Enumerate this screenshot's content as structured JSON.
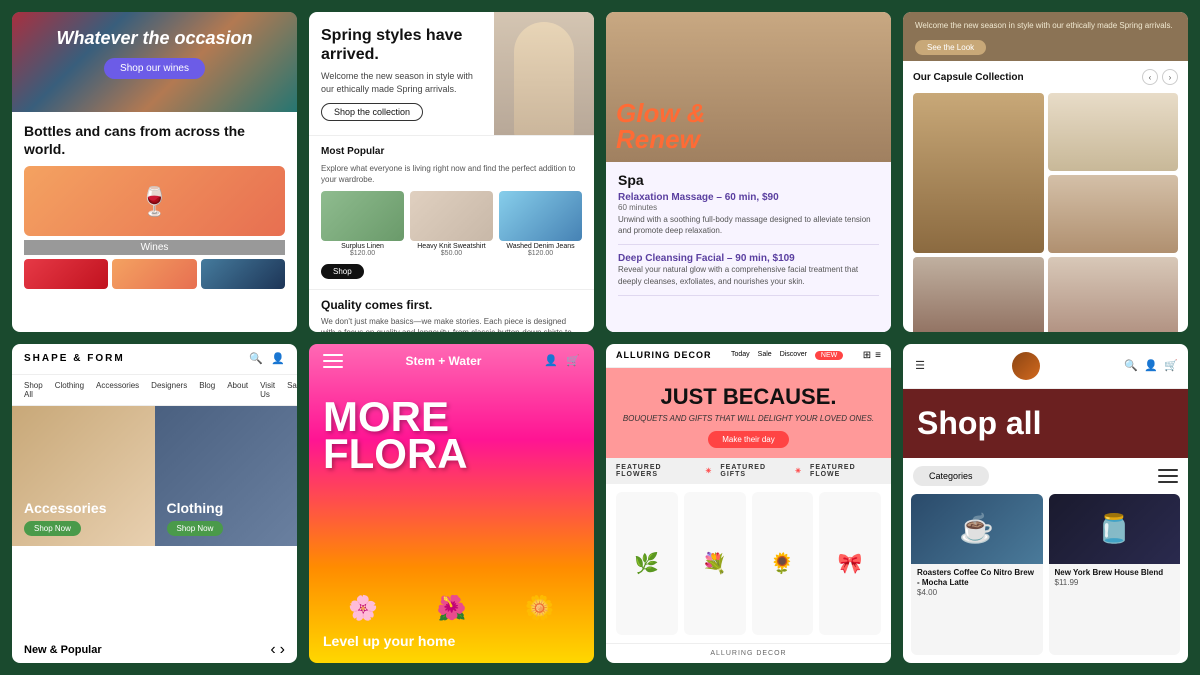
{
  "background_color": "#1a4a2e",
  "cards": {
    "card1": {
      "top_title": "Whatever the occasion",
      "top_btn": "Shop our wines",
      "bottles_title": "Bottles and cans from across the world.",
      "label": "Wines"
    },
    "card2": {
      "spring_title": "Spring styles have arrived.",
      "spring_sub": "Welcome the new season in style with our ethically made Spring arrivals.",
      "spring_btn": "Shop the collection",
      "most_popular": "Most Popular",
      "explore": "Explore what everyone is living right now and find the perfect addition to your wardrobe.",
      "shop_btn": "Shop",
      "products": [
        {
          "name": "Surplus Linen",
          "price": "$120.00"
        },
        {
          "name": "Heavy Knit Sweatshirt",
          "price": "$50.00"
        },
        {
          "name": "Washed Denim Jeans",
          "price": "$120.00"
        }
      ],
      "quality_title": "Quality comes first.",
      "quality_text": "We don't just make basics—we make stories. Each piece is designed with a focus on quality and longevity, from classic button-down shirts to sleek blazers and comfortable yet stylish jeans. We're dedicated to using only sustainable materials, so you can feel good knowing that your purchase supports ethical and eco-friendly practices."
    },
    "card3": {
      "glow_title": "Glow & Renew",
      "spa_title": "Spa",
      "service1_name": "Relaxation Massage – 60 min, $90",
      "service1_time": "60 minutes",
      "service1_desc": "Unwind with a soothing full-body massage designed to alleviate tension and promote deep relaxation.",
      "service2_name": "Deep Cleansing Facial – 90 min, $109",
      "service2_desc": "Reveal your natural glow with a comprehensive facial treatment that deeply cleanses, exfoliates, and nourishes your skin."
    },
    "card4": {
      "welcome_text": "Welcome the new season in style with our ethically made Spring arrivals.",
      "look_btn": "See the Look",
      "capsule_title": "Our Capsule Collection"
    },
    "card5": {
      "logo": "SHAPE & FORM",
      "nav_items": [
        "Shop All",
        "Clothing",
        "Accessories",
        "Designers",
        "Blog",
        "About",
        "Visit Us",
        "Sale"
      ],
      "accessories_label": "Accessories",
      "clothing_label": "Clothing",
      "shop_now": "Shop Now",
      "new_popular": "New & Popular"
    },
    "card6": {
      "logo": "Stem + Water",
      "flora_title": "MORE FLORA",
      "level_up": "Level up your home"
    },
    "card7": {
      "logo": "ALLURING DECOR",
      "nav_items": [
        "Today",
        "Sale",
        "Discover",
        "New"
      ],
      "new_badge": "NEW",
      "just_because_title": "JUST BECAUSE.",
      "jb_sub": "BOUQUETS AND GIFTS THAT WILL DELIGHT YOUR LOVED ONES.",
      "make_day_btn": "Make their day",
      "featured_flowers": "FEATURED FLOWERS",
      "featured_gifts": "FEATURED GIFTS",
      "featured_flowers2": "FEATURED FLOWE",
      "footer": "ALLURING DECOR"
    },
    "card8": {
      "shop_all_title": "Shop all",
      "categories_label": "Categories",
      "products": [
        {
          "name": "Roasters Coffee Co Nitro Brew - Mocha Latte",
          "price": "$4.00"
        },
        {
          "name": "New York Brew House Blend",
          "price": "$11.99"
        }
      ]
    }
  },
  "icons": {
    "search": "🔍",
    "user": "👤",
    "cart": "🛒",
    "menu": "☰",
    "heart": "♡",
    "arrow_left": "‹",
    "arrow_right": "›",
    "filter": "⊟"
  }
}
